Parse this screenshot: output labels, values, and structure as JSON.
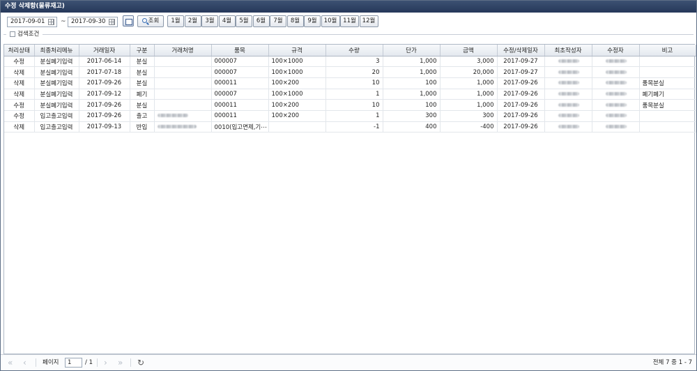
{
  "window": {
    "title": "수정 삭제항(물류재고)"
  },
  "toolbar": {
    "start_date": "2017-09-01",
    "end_date": "2017-09-30",
    "tilde": "~",
    "search_label": "조회",
    "months": [
      "1월",
      "2월",
      "3월",
      "4월",
      "5월",
      "6월",
      "7월",
      "8월",
      "9월",
      "10월",
      "11월",
      "12월"
    ]
  },
  "filter": {
    "label": "검색조건"
  },
  "grid": {
    "columns": [
      "처리상태",
      "최종처리메뉴",
      "거래일자",
      "구분",
      "거래처명",
      "품목",
      "규격",
      "수량",
      "단가",
      "금액",
      "수정/삭제일자",
      "최초작성자",
      "수정자",
      "비고"
    ],
    "rows": [
      [
        "수정",
        "분실폐기입력",
        "2017-06-14",
        "분실",
        "",
        "000007",
        "100×1000",
        "3",
        "1,000",
        "3,000",
        "2017-09-27",
        "",
        "",
        " "
      ],
      [
        "삭제",
        "분실폐기입력",
        "2017-07-18",
        "분실",
        "",
        "000007",
        "100×1000",
        "20",
        "1,000",
        "20,000",
        "2017-09-27",
        "",
        "",
        ""
      ],
      [
        "삭제",
        "분실폐기입력",
        "2017-09-26",
        "분실",
        "",
        "000011",
        "100×200",
        "10",
        "100",
        "1,000",
        "2017-09-26",
        "",
        "",
        "품목분실"
      ],
      [
        "삭제",
        "분실폐기입력",
        "2017-09-12",
        "폐기",
        "",
        "000007",
        "100×1000",
        "1",
        "1,000",
        "1,000",
        "2017-09-26",
        "",
        "",
        "폐기폐기"
      ],
      [
        "수정",
        "분실폐기입력",
        "2017-09-26",
        "분실",
        "",
        "000011",
        "100×200",
        "10",
        "100",
        "1,000",
        "2017-09-26",
        "",
        "",
        "품목분실"
      ],
      [
        "수정",
        "입고출고입력",
        "2017-09-26",
        "출고",
        "",
        "000011",
        "100×200",
        "1",
        "300",
        "300",
        "2017-09-26",
        "",
        "",
        ""
      ],
      [
        "삭제",
        "입고출고입력",
        "2017-09-13",
        "반입",
        "",
        "0010(입고면제,기⋯",
        "",
        "-1",
        "400",
        "-400",
        "2017-09-26",
        "",
        "",
        ""
      ]
    ]
  },
  "pager": {
    "page_label": "페이지",
    "page_value": "1",
    "total_pages": "/ 1",
    "info": "전체 7 중 1 - 7"
  }
}
